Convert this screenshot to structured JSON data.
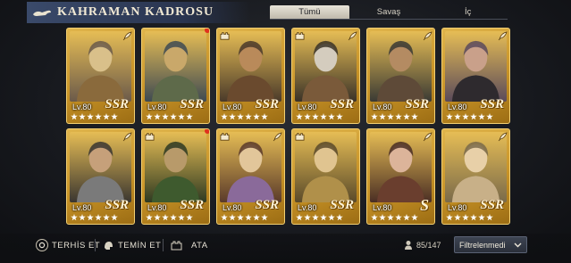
{
  "header": {
    "title": "KAHRAMAN KADROSU",
    "icon": "magic-lamp-icon"
  },
  "tabs": [
    {
      "label": "Tümü",
      "active": true
    },
    {
      "label": "Savaş",
      "active": false
    },
    {
      "label": "İç",
      "active": false
    }
  ],
  "heroes": [
    {
      "level": "Lv.80",
      "rarity": "SSR",
      "stars": 6,
      "left_icon": "none",
      "right_icon": "quill-icon",
      "dot": false,
      "palette": [
        "#d9c08a",
        "#8a6a3c",
        "#6b5a4a"
      ]
    },
    {
      "level": "Lv.80",
      "rarity": "SSR",
      "stars": 6,
      "left_icon": "none",
      "right_icon": "none",
      "dot": true,
      "palette": [
        "#c9a86a",
        "#5e6a4a",
        "#3e4a52"
      ]
    },
    {
      "level": "Lv.80",
      "rarity": "SSR",
      "stars": 6,
      "left_icon": "castle-icon",
      "right_icon": "none",
      "dot": false,
      "palette": [
        "#b98a5a",
        "#6a4a2e",
        "#4a3a2a"
      ]
    },
    {
      "level": "Lv.80",
      "rarity": "SSR",
      "stars": 6,
      "left_icon": "castle-icon",
      "right_icon": "quill-icon",
      "dot": false,
      "palette": [
        "#d4ccbe",
        "#7a5a3a",
        "#3a3228"
      ]
    },
    {
      "level": "Lv.80",
      "rarity": "SSR",
      "stars": 6,
      "left_icon": "none",
      "right_icon": "quill-icon",
      "dot": false,
      "palette": [
        "#b48b62",
        "#5e4a38",
        "#3a3a34"
      ]
    },
    {
      "level": "Lv.80",
      "rarity": "SSR",
      "stars": 6,
      "left_icon": "none",
      "right_icon": "quill-icon",
      "dot": false,
      "palette": [
        "#c9a08a",
        "#2e2a2e",
        "#5a4a5a"
      ]
    },
    {
      "level": "Lv.80",
      "rarity": "SSR",
      "stars": 6,
      "left_icon": "none",
      "right_icon": "quill-icon",
      "dot": false,
      "palette": [
        "#c6a07a",
        "#7a7a7a",
        "#3a3630"
      ]
    },
    {
      "level": "Lv.80",
      "rarity": "SSR",
      "stars": 6,
      "left_icon": "castle-icon",
      "right_icon": "none",
      "dot": true,
      "palette": [
        "#b89a6a",
        "#3e5a2e",
        "#2e3a22"
      ]
    },
    {
      "level": "Lv.80",
      "rarity": "SSR",
      "stars": 6,
      "left_icon": "castle-icon",
      "right_icon": "quill-icon",
      "dot": false,
      "palette": [
        "#e2c69a",
        "#8a6a9a",
        "#5a3a2a"
      ]
    },
    {
      "level": "Lv.80",
      "rarity": "SSR",
      "stars": 6,
      "left_icon": "castle-icon",
      "right_icon": "none",
      "dot": false,
      "palette": [
        "#e0c490",
        "#b0904a",
        "#5a4a2a"
      ]
    },
    {
      "level": "Lv.80",
      "rarity": "S",
      "stars": 6,
      "left_icon": "none",
      "right_icon": "quill-icon",
      "dot": false,
      "palette": [
        "#dcb49a",
        "#6a3e2e",
        "#4a2e24"
      ]
    },
    {
      "level": "Lv.80",
      "rarity": "SSR",
      "stars": 6,
      "left_icon": "none",
      "right_icon": "quill-icon",
      "dot": false,
      "palette": [
        "#e8d0a8",
        "#c8b088",
        "#7a6a4a"
      ]
    }
  ],
  "bottom": {
    "dismiss_label": "TERHİS ET",
    "dismiss_icon": "recycle-icon",
    "recruit_label": "TEMİN ET",
    "recruit_icon": "helmet-icon",
    "assign_label": "ATA",
    "assign_icon": "castle-icon",
    "hero_count": "85/147",
    "count_icon": "hero-bust-icon",
    "filter_label": "Filtrelenmedi",
    "filter_icon": "chevron-down-icon"
  }
}
